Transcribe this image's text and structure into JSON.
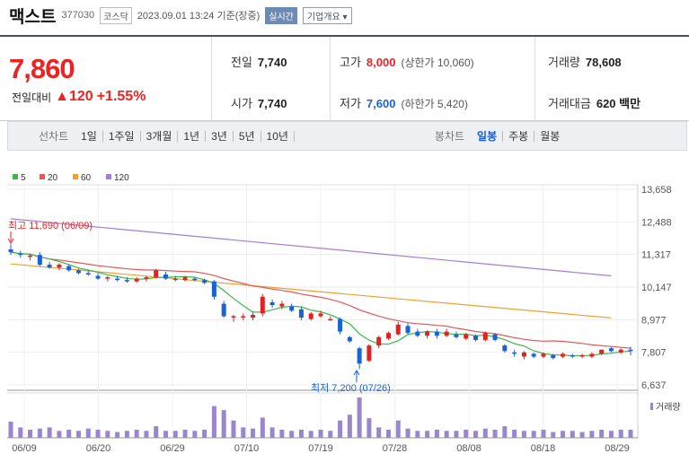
{
  "header": {
    "stock_name": "맥스트",
    "stock_code": "377030",
    "market_badge": "코스닥",
    "datetime": "2023.09.01 13:24 기준(장중)",
    "realtime_label": "실시간",
    "overview_label": "기업개요 ▾"
  },
  "price": {
    "current": "7,860",
    "change_label": "전일대비",
    "change_value": "▲120",
    "change_pct": "+1.55%"
  },
  "stats": {
    "prev_label": "전일",
    "prev_value": "7,740",
    "high_label": "고가",
    "high_value": "8,000",
    "upper_limit": "(상한가 10,060)",
    "volume_label": "거래량",
    "volume_value": "78,608",
    "open_label": "시가",
    "open_value": "7,740",
    "low_label": "저가",
    "low_value": "7,600",
    "lower_limit": "(하한가 5,420)",
    "amount_label": "거래대금",
    "amount_value": "620 백만"
  },
  "tabs": {
    "line_label": "선차트",
    "line_tabs": [
      "1일",
      "1주일",
      "3개월",
      "1년",
      "3년",
      "5년",
      "10년"
    ],
    "candle_label": "봉차트",
    "candle_tabs": [
      "일봉",
      "주봉",
      "월봉"
    ],
    "active_candle": "일봉"
  },
  "colors": {
    "up": "#e22222",
    "down": "#1a63d6",
    "ma5": "#3cb84a",
    "ma20": "#e05a5a",
    "ma60": "#f0a030",
    "ma120": "#a77bd6",
    "volume": "#9a86cc"
  },
  "chart_data": {
    "type": "candlestick",
    "legend": [
      "5",
      "20",
      "60",
      "120"
    ],
    "y_ticks": [
      "13,658",
      "12,488",
      "11,317",
      "10,147",
      "8,977",
      "7,807",
      "6,637"
    ],
    "ylim": [
      6637,
      13658
    ],
    "x_ticks": [
      "06/09",
      "06/20",
      "06/29",
      "07/10",
      "07/19",
      "07/28",
      "08/08",
      "08/18",
      "08/29"
    ],
    "volume_label": "거래량",
    "annotations": {
      "high_text": "최고 11,690 (06/09)",
      "low_text": "최저 7,200 (07/26)"
    },
    "candles": [
      {
        "o": 11500,
        "h": 11690,
        "l": 11300,
        "c": 11400
      },
      {
        "o": 11350,
        "h": 11450,
        "l": 11200,
        "c": 11300
      },
      {
        "o": 11250,
        "h": 11350,
        "l": 11100,
        "c": 11280
      },
      {
        "o": 11300,
        "h": 11400,
        "l": 10900,
        "c": 10950
      },
      {
        "o": 10950,
        "h": 11050,
        "l": 10800,
        "c": 10850
      },
      {
        "o": 10850,
        "h": 11000,
        "l": 10750,
        "c": 10950
      },
      {
        "o": 10900,
        "h": 10950,
        "l": 10700,
        "c": 10750
      },
      {
        "o": 10750,
        "h": 10800,
        "l": 10600,
        "c": 10650
      },
      {
        "o": 10650,
        "h": 10750,
        "l": 10550,
        "c": 10600
      },
      {
        "o": 10550,
        "h": 10650,
        "l": 10400,
        "c": 10450
      },
      {
        "o": 10450,
        "h": 10550,
        "l": 10350,
        "c": 10500
      },
      {
        "o": 10450,
        "h": 10550,
        "l": 10350,
        "c": 10400
      },
      {
        "o": 10400,
        "h": 10500,
        "l": 10300,
        "c": 10350
      },
      {
        "o": 10350,
        "h": 10500,
        "l": 10300,
        "c": 10450
      },
      {
        "o": 10450,
        "h": 10550,
        "l": 10350,
        "c": 10500
      },
      {
        "o": 10500,
        "h": 10800,
        "l": 10450,
        "c": 10750
      },
      {
        "o": 10600,
        "h": 10700,
        "l": 10400,
        "c": 10450
      },
      {
        "o": 10450,
        "h": 10550,
        "l": 10350,
        "c": 10400
      },
      {
        "o": 10400,
        "h": 10550,
        "l": 10350,
        "c": 10500
      },
      {
        "o": 10450,
        "h": 10500,
        "l": 10350,
        "c": 10400
      },
      {
        "o": 10400,
        "h": 10450,
        "l": 10250,
        "c": 10300
      },
      {
        "o": 10350,
        "h": 10400,
        "l": 9700,
        "c": 9800
      },
      {
        "o": 9550,
        "h": 9650,
        "l": 9050,
        "c": 9100
      },
      {
        "o": 9050,
        "h": 9150,
        "l": 8900,
        "c": 9100
      },
      {
        "o": 9050,
        "h": 9200,
        "l": 8950,
        "c": 9100
      },
      {
        "o": 9050,
        "h": 9250,
        "l": 8950,
        "c": 9150
      },
      {
        "o": 9200,
        "h": 9900,
        "l": 9100,
        "c": 9800
      },
      {
        "o": 9600,
        "h": 9700,
        "l": 9400,
        "c": 9500
      },
      {
        "o": 9450,
        "h": 9650,
        "l": 9350,
        "c": 9550
      },
      {
        "o": 9450,
        "h": 9550,
        "l": 9250,
        "c": 9300
      },
      {
        "o": 9350,
        "h": 9450,
        "l": 8950,
        "c": 9050
      },
      {
        "o": 9000,
        "h": 9250,
        "l": 8950,
        "c": 9200
      },
      {
        "o": 9100,
        "h": 9300,
        "l": 9050,
        "c": 9200
      },
      {
        "o": 9000,
        "h": 9100,
        "l": 8950,
        "c": 9000
      },
      {
        "o": 9000,
        "h": 9050,
        "l": 8450,
        "c": 8550
      },
      {
        "o": 8350,
        "h": 8400,
        "l": 8150,
        "c": 8200
      },
      {
        "o": 7950,
        "h": 8000,
        "l": 7200,
        "c": 7400
      },
      {
        "o": 7500,
        "h": 8100,
        "l": 7450,
        "c": 8050
      },
      {
        "o": 8050,
        "h": 8400,
        "l": 7950,
        "c": 8350
      },
      {
        "o": 8300,
        "h": 8550,
        "l": 8250,
        "c": 8500
      },
      {
        "o": 8450,
        "h": 8900,
        "l": 8400,
        "c": 8800
      },
      {
        "o": 8750,
        "h": 8850,
        "l": 8450,
        "c": 8500
      },
      {
        "o": 8550,
        "h": 8650,
        "l": 8350,
        "c": 8400
      },
      {
        "o": 8400,
        "h": 8600,
        "l": 8300,
        "c": 8550
      },
      {
        "o": 8550,
        "h": 8650,
        "l": 8300,
        "c": 8400
      },
      {
        "o": 8400,
        "h": 8650,
        "l": 8350,
        "c": 8550
      },
      {
        "o": 8450,
        "h": 8550,
        "l": 8300,
        "c": 8350
      },
      {
        "o": 8300,
        "h": 8500,
        "l": 8250,
        "c": 8450
      },
      {
        "o": 8400,
        "h": 8450,
        "l": 8200,
        "c": 8250
      },
      {
        "o": 8250,
        "h": 8550,
        "l": 8200,
        "c": 8500
      },
      {
        "o": 8450,
        "h": 8500,
        "l": 8200,
        "c": 8250
      },
      {
        "o": 8050,
        "h": 8100,
        "l": 7800,
        "c": 7850
      },
      {
        "o": 7800,
        "h": 7900,
        "l": 7650,
        "c": 7750
      },
      {
        "o": 7650,
        "h": 7850,
        "l": 7550,
        "c": 7800
      },
      {
        "o": 7750,
        "h": 7800,
        "l": 7600,
        "c": 7650
      },
      {
        "o": 7650,
        "h": 7800,
        "l": 7600,
        "c": 7750
      },
      {
        "o": 7700,
        "h": 7750,
        "l": 7550,
        "c": 7600
      },
      {
        "o": 7650,
        "h": 7800,
        "l": 7600,
        "c": 7750
      },
      {
        "o": 7700,
        "h": 7750,
        "l": 7600,
        "c": 7650
      },
      {
        "o": 7650,
        "h": 7750,
        "l": 7600,
        "c": 7700
      },
      {
        "o": 7650,
        "h": 7800,
        "l": 7600,
        "c": 7750
      },
      {
        "o": 7750,
        "h": 7900,
        "l": 7700,
        "c": 7900
      },
      {
        "o": 7950,
        "h": 8000,
        "l": 7800,
        "c": 7850
      },
      {
        "o": 7800,
        "h": 7950,
        "l": 7750,
        "c": 7900
      },
      {
        "o": 7900,
        "h": 8000,
        "l": 7700,
        "c": 7860
      }
    ],
    "volumes": [
      28,
      18,
      14,
      16,
      18,
      12,
      14,
      12,
      16,
      14,
      12,
      10,
      12,
      14,
      12,
      20,
      12,
      12,
      14,
      12,
      14,
      55,
      48,
      30,
      18,
      16,
      35,
      18,
      14,
      12,
      14,
      12,
      14,
      12,
      30,
      40,
      70,
      34,
      18,
      14,
      30,
      16,
      12,
      12,
      14,
      12,
      12,
      14,
      12,
      16,
      14,
      20,
      14,
      12,
      12,
      14,
      10,
      12,
      12,
      10,
      12,
      14,
      12,
      14,
      14
    ],
    "ma60": [
      [
        0,
        10980
      ],
      [
        62,
        9040
      ]
    ],
    "ma120": [
      [
        0,
        12600
      ],
      [
        62,
        10550
      ]
    ]
  }
}
